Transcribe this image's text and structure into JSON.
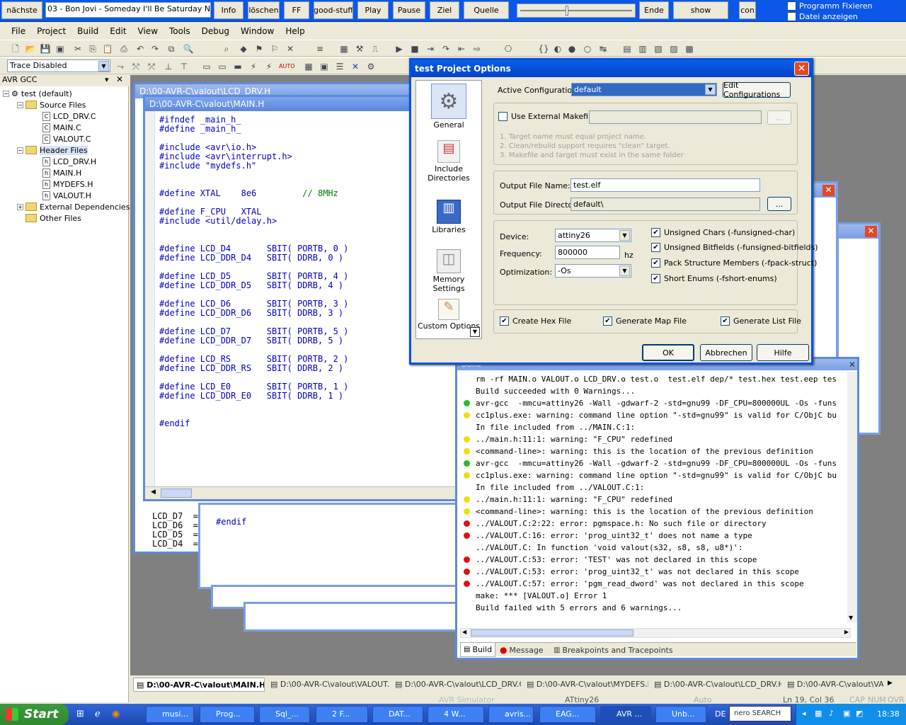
{
  "musicbar": {
    "next": "nächste",
    "track": "03 - Bon Jovi - Someday I'll Be Saturday Night.n",
    "info": "Info",
    "delete": "löschen",
    "ff": "FF",
    "goodstuff": "good-stuff",
    "play": "Play",
    "pause": "Pause",
    "target": "Ziel",
    "source": "Quelle",
    "end": "Ende",
    "show": "show",
    "con": "con",
    "fix_program": "Programm Fixieren",
    "show_file": "Datei anzeigen"
  },
  "menu": [
    "File",
    "Project",
    "Build",
    "Edit",
    "View",
    "Tools",
    "Debug",
    "Window",
    "Help"
  ],
  "toolbar": {
    "trace": "Trace Disabled"
  },
  "left_panel": {
    "title": "AVR GCC",
    "root": "test (default)",
    "source_files": "Source Files",
    "sources": [
      "LCD_DRV.C",
      "MAIN.C",
      "VALOUT.C"
    ],
    "header_files": "Header Files",
    "headers": [
      "LCD_DRV.H",
      "MAIN.H",
      "MYDEFS.H",
      "VALOUT.H"
    ],
    "external": "External Dependencies",
    "other": "Other Files"
  },
  "editor": {
    "back_title": "D:\\00-AVR-C\\valout\\LCD_DRV.H",
    "title": "D:\\00-AVR-C\\valout\\MAIN.H",
    "lines": [
      "#ifndef _main_h_",
      "#define _main_h_",
      "",
      "#include <avr\\io.h>",
      "#include <avr\\interrupt.h>",
      "#include \"mydefs.h\"",
      "",
      "",
      "#define XTAL    8e6         // 8MHz",
      "",
      "#define F_CPU   XTAL",
      "#include <util/delay.h>",
      "",
      "",
      "#define LCD_D4       SBIT( PORTB, 0 )",
      "#define LCD_DDR_D4   SBIT( DDRB, 0 )",
      "",
      "#define LCD_D5       SBIT( PORTB, 4 )",
      "#define LCD_DDR_D5   SBIT( DDRB, 4 )",
      "",
      "#define LCD_D6       SBIT( PORTB, 3 )",
      "#define LCD_DDR_D6   SBIT( DDRB, 3 )",
      "",
      "#define LCD_D7       SBIT( PORTB, 5 )",
      "#define LCD_DDR_D7   SBIT( DDRB, 5 )",
      "",
      "#define LCD_RS       SBIT( PORTB, 2 )",
      "#define LCD_DDR_RS   SBIT( DDRB, 2 )",
      "",
      "#define LCD_E0       SBIT( PORTB, 1 )",
      "#define LCD_DDR_E0   SBIT( DDRB, 1 )",
      "",
      "",
      "#endif"
    ],
    "behind_lines": [
      "LCD_D7  =",
      "LCD_D6  =",
      "LCD_D5  =",
      "LCD_D4  ="
    ],
    "behind_endif": "#endif"
  },
  "dialog": {
    "title": "test Project Options",
    "sidebar": [
      "General",
      "Include Directories",
      "Libraries",
      "Memory Settings",
      "Custom Options"
    ],
    "active_config_label": "Active Configuration",
    "active_config_value": "default",
    "edit_configs": "Edit Configurations",
    "use_external_makefile": "Use External Makefile",
    "browse": "...",
    "notes": [
      "1. Target name must equal project name.",
      "2. Clean/rebuild support requires  \"clean\" target.",
      "3. Makefile and target must exist in the same folder"
    ],
    "output_file_name_label": "Output File Name:",
    "output_file_name": "test.elf",
    "output_dir_label": "Output File Directory:",
    "output_dir": "default\\",
    "device_label": "Device:",
    "device": "attiny26",
    "frequency_label": "Frequency:",
    "frequency": "800000",
    "hz": "hz",
    "optimization_label": "Optimization:",
    "optimization": "-Os",
    "opts": [
      "Unsigned Chars (-funsigned-char)",
      "Unsigned Bitfields (-funsigned-bitfields)",
      "Pack Structure Members (-fpack-struct)",
      "Short Enums (-fshort-enums)"
    ],
    "create_hex": "Create Hex File",
    "gen_map": "Generate Map File",
    "gen_list": "Generate List File",
    "ok": "OK",
    "cancel": "Abbrechen",
    "help": "Hilfe"
  },
  "build": {
    "title": "Build",
    "lines": [
      {
        "dot": "",
        "text": "rm -rf MAIN.o VALOUT.o LCD_DRV.o test.o  test.elf dep/* test.hex test.eep tes"
      },
      {
        "dot": "",
        "text": "Build succeeded with 0 Warnings..."
      },
      {
        "dot": "green",
        "text": "avr-gcc  -mmcu=attiny26 -Wall -gdwarf-2 -std=gnu99 -DF_CPU=800000UL -Os -funs"
      },
      {
        "dot": "yellow",
        "text": "cc1plus.exe: warning: command line option \"-std=gnu99\" is valid for C/ObjC bu"
      },
      {
        "dot": "",
        "text": "In file included from ../MAIN.C:1:"
      },
      {
        "dot": "yellow",
        "text": "../main.h:11:1: warning: \"F_CPU\" redefined"
      },
      {
        "dot": "yellow",
        "text": "<command-line>: warning: this is the location of the previous definition"
      },
      {
        "dot": "green",
        "text": "avr-gcc  -mmcu=attiny26 -Wall -gdwarf-2 -std=gnu99 -DF_CPU=800000UL -Os -funs"
      },
      {
        "dot": "yellow",
        "text": "cc1plus.exe: warning: command line option \"-std=gnu99\" is valid for C/ObjC bu"
      },
      {
        "dot": "",
        "text": "In file included from ../VALOUT.C:1:"
      },
      {
        "dot": "yellow",
        "text": "../main.h:11:1: warning: \"F_CPU\" redefined"
      },
      {
        "dot": "yellow",
        "text": "<command-line>: warning: this is the location of the previous definition"
      },
      {
        "dot": "red",
        "text": "../VALOUT.C:2:22: error: pgmspace.h: No such file or directory"
      },
      {
        "dot": "red",
        "text": "../VALOUT.C:16: error: 'prog_uint32_t' does not name a type"
      },
      {
        "dot": "",
        "text": "../VALOUT.C: In function 'void valout(s32, s8, s8, u8*)':"
      },
      {
        "dot": "red",
        "text": "../VALOUT.C:53: error: 'TEST' was not declared in this scope"
      },
      {
        "dot": "red",
        "text": "../VALOUT.C:53: error: 'prog_uint32_t' was not declared in this scope"
      },
      {
        "dot": "red",
        "text": "../VALOUT.C:57: error: 'pgm_read_dword' was not declared in this scope"
      },
      {
        "dot": "",
        "text": "make: *** [VALOUT.o] Error 1"
      },
      {
        "dot": "",
        "text": "Build failed with 5 errors and 6 warnings..."
      }
    ],
    "tabs": [
      "Build",
      "Message",
      "Breakpoints and Tracepoints"
    ]
  },
  "doc_tabs": [
    "D:\\00-AVR-C\\valout\\MAIN.H",
    "D:\\00-AVR-C\\valout\\VALOUT.C",
    "D:\\00-AVR-C\\valout\\LCD_DRV.C",
    "D:\\00-AVR-C\\valout\\MYDEFS.H",
    "D:\\00-AVR-C\\valout\\LCD_DRV.H",
    "D:\\00-AVR-C\\valout\\VAL"
  ],
  "status": {
    "sim": "AVR Simulator",
    "device": "ATtiny26",
    "auto": "Auto",
    "pos": "Ln 19, Col 36",
    "caps": "CAP",
    "num": "NUM",
    "ovr": "OVR"
  },
  "taskbar": {
    "start": "Start",
    "tasks": [
      "musi...",
      "Prog...",
      "Sql_...",
      "2 F...",
      "DAT...",
      "4 W...",
      "avris...",
      "EAG...",
      "AVR ...",
      "Unb..."
    ],
    "lang": "DE",
    "nero": "nero SEARCH",
    "clock": "18:38"
  },
  "colors": {
    "accent": "#0054e3",
    "error": "#e01010",
    "warning": "#f0e000",
    "ok": "#20c020"
  }
}
